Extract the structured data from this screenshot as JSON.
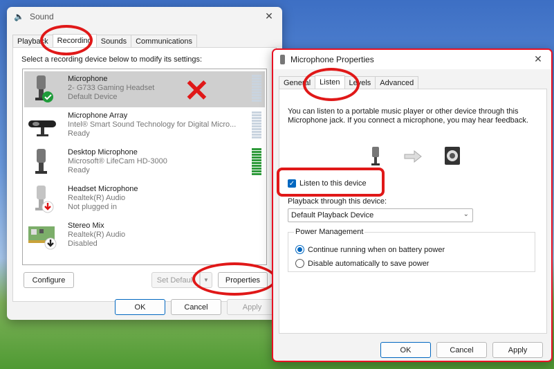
{
  "sound": {
    "title": "Sound",
    "tabs": [
      "Playback",
      "Recording",
      "Sounds",
      "Communications"
    ],
    "instruction": "Select a recording device below to modify its settings:",
    "devices": [
      {
        "name": "Microphone",
        "desc": "2- G733 Gaming Headset",
        "state": "Default Device"
      },
      {
        "name": "Microphone Array",
        "desc": "Intel® Smart Sound Technology for Digital Micro...",
        "state": "Ready"
      },
      {
        "name": "Desktop Microphone",
        "desc": "Microsoft® LifeCam HD-3000",
        "state": "Ready"
      },
      {
        "name": "Headset Microphone",
        "desc": "Realtek(R) Audio",
        "state": "Not plugged in"
      },
      {
        "name": "Stereo Mix",
        "desc": "Realtek(R) Audio",
        "state": "Disabled"
      }
    ],
    "configure": "Configure",
    "set_default": "Set Default",
    "properties": "Properties",
    "ok": "OK",
    "cancel": "Cancel",
    "apply": "Apply"
  },
  "mic": {
    "title": "Microphone Properties",
    "tabs": [
      "General",
      "Listen",
      "Levels",
      "Advanced"
    ],
    "description": "You can listen to a portable music player or other device through this Microphone jack.  If you connect a microphone, you may hear feedback.",
    "listen_label": "Listen to this device",
    "playback_label": "Playback through this device:",
    "playback_value": "Default Playback Device",
    "power_title": "Power Management",
    "radio_continue": "Continue running when on battery power",
    "radio_disable": "Disable automatically to save power",
    "ok": "OK",
    "cancel": "Cancel",
    "apply": "Apply"
  },
  "colors": {
    "accent": "#0067c0",
    "annotation": "#e01818",
    "active_title": "#e81123"
  }
}
